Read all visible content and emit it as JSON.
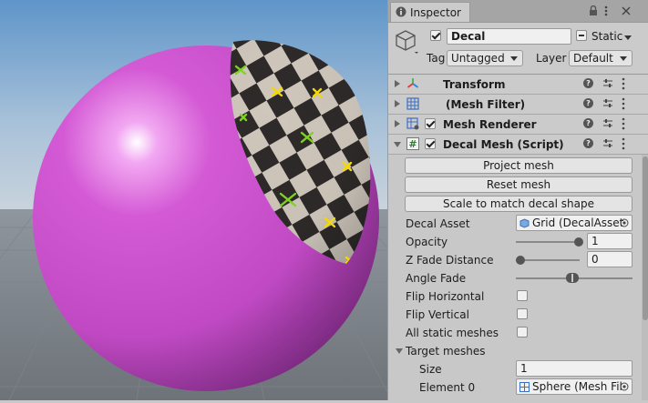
{
  "colors": {
    "panel": "#c8c8c8",
    "sphere": "#d04fd2",
    "checker_dark": "#2e2a2a",
    "checker_light": "#cfc7bc",
    "cross_green": "#7ed321",
    "cross_yellow": "#f5d800"
  },
  "inspector": {
    "tab_label": "Inspector",
    "tab_icon": "info-icon",
    "object": {
      "name": "Decal",
      "active": true,
      "static_label": "Static",
      "static_checked": false,
      "tag_label": "Tag",
      "tag_value": "Untagged",
      "layer_label": "Layer",
      "layer_value": "Default"
    },
    "components": [
      {
        "title": "Transform",
        "icon": "transform-icon",
        "has_checkbox": false,
        "expanded": false
      },
      {
        "title": "(Mesh Filter)",
        "icon": "mesh-filter-icon",
        "has_checkbox": false,
        "expanded": false
      },
      {
        "title": "Mesh Renderer",
        "icon": "mesh-renderer-icon",
        "has_checkbox": true,
        "expanded": false
      },
      {
        "title": "Decal Mesh (Script)",
        "icon": "script-icon",
        "has_checkbox": true,
        "expanded": true
      }
    ],
    "buttons": [
      "Project mesh",
      "Reset mesh",
      "Scale to match decal shape"
    ],
    "props": {
      "decal_asset_label": "Decal Asset",
      "decal_asset_value": "Grid (DecalAsset",
      "opacity_label": "Opacity",
      "opacity_value": "1",
      "opacity_fraction": 1.0,
      "z_fade_label": "Z Fade Distance",
      "z_fade_value": "0",
      "z_fade_fraction": 0.0,
      "angle_fade_label": "Angle Fade",
      "flip_h_label": "Flip Horizontal",
      "flip_v_label": "Flip Vertical",
      "all_static_label": "All static meshes",
      "target_meshes_label": "Target meshes",
      "size_label": "Size",
      "size_value": "1",
      "element0_label": "Element 0",
      "element0_value": "Sphere (Mesh Fil"
    }
  }
}
